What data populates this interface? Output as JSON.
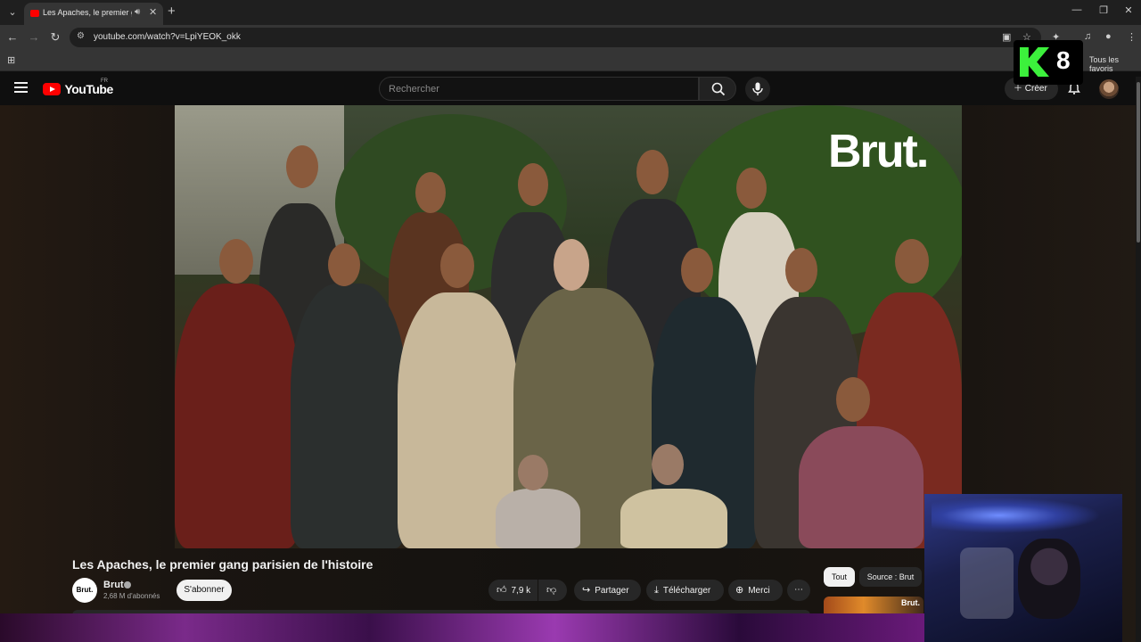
{
  "browser": {
    "tab_title": "Les Apaches, le premier gang parisien de l'histoire",
    "url": "youtube.com/watch?v=LpiYEOK_okk",
    "bookmarks_label": "Tous les favoris"
  },
  "header": {
    "logo_text": "YouTube",
    "logo_region": "FR",
    "search_placeholder": "Rechercher",
    "create_label": "Créer"
  },
  "overlay": {
    "k8_text": "8"
  },
  "video": {
    "brand_watermark": "Brut.",
    "title": "Les Apaches, le premier gang parisien de l'histoire"
  },
  "channel": {
    "avatar_text": "Brut.",
    "name": "Brut",
    "subscribers": "2,68 M d'abonnés",
    "subscribe_label": "S'abonner"
  },
  "actions": {
    "likes": "7,9 k",
    "share_label": "Partager",
    "download_label": "Télécharger",
    "thanks_label": "Merci",
    "more_label": "⋯"
  },
  "related": {
    "chips": [
      "Tout",
      "Source : Brut"
    ],
    "thumb_text": "Brut."
  },
  "colors": {
    "brand_red": "#ff0000",
    "k8_green": "#3cf03c",
    "background": "#0f0f0f"
  }
}
